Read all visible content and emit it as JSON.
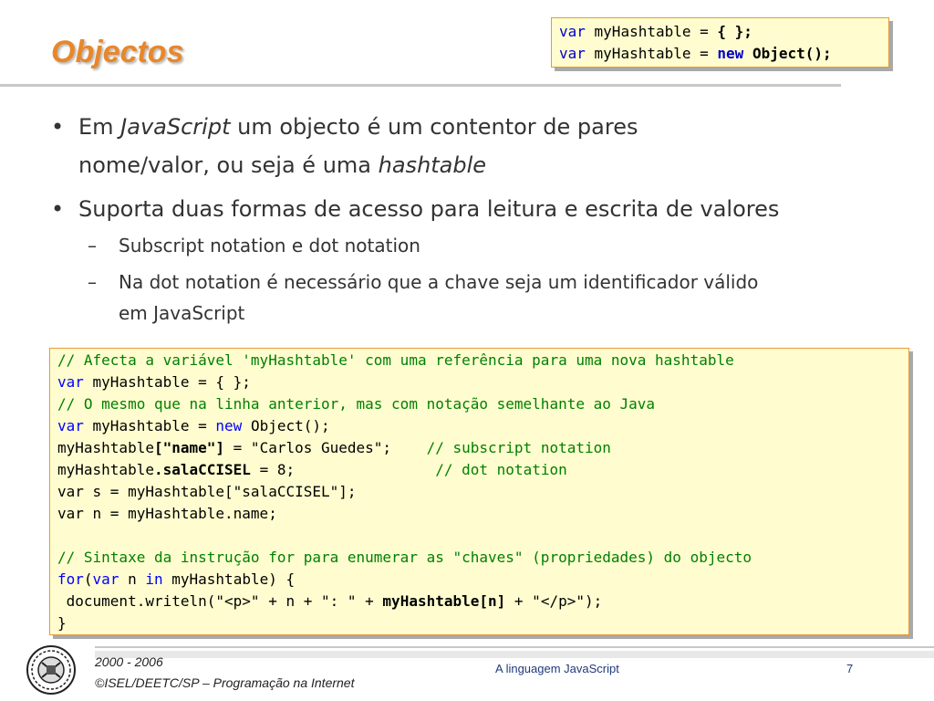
{
  "slide": {
    "title": "Objectos",
    "top_code": {
      "line1": {
        "kw": "var",
        "text": " myHashtable = ",
        "bold": "{ };"
      },
      "line2": {
        "kw": "var",
        "text": " myHashtable = ",
        "new": "new",
        "bold": " Object();"
      }
    },
    "bullets": [
      {
        "t1": "Em ",
        "i1": "JavaScript",
        "t2": " um objecto é um contentor de pares",
        "t3": "nome/valor, ou seja é uma ",
        "i2": "hashtable"
      },
      {
        "t1": "Suporta duas formas de acesso para leitura e escrita de valores"
      }
    ],
    "sub_bullets": [
      {
        "text": "Subscript notation e dot notation"
      },
      {
        "line1": "Na dot notation é necessário que a chave seja um identificador válido",
        "line2": "em JavaScript"
      }
    ],
    "bullet_glyph": "•",
    "dash_glyph": "–",
    "code": {
      "l1": "// Afecta a variável 'myHashtable' com uma referência para uma nova hashtable",
      "l2_kw": "var",
      "l2": " myHashtable = { };",
      "l3": "// O mesmo que na linha anterior, mas com notação semelhante ao Java",
      "l4_kw": "var",
      "l4_a": " myHashtable = ",
      "l4_kw2": "new",
      "l4_b": " Object();",
      "l5_a": "myHashtable",
      "l5_b": "[\"name\"]",
      "l5_c": " = \"Carlos Guedes\";    ",
      "l5_cm": "// subscript notation",
      "l6_a": "myHashtable",
      "l6_b": ".salaCCISEL",
      "l6_c": " = 8;                ",
      "l6_cm": "// dot notation",
      "l7": "var s = myHashtable[\"salaCCISEL\"];",
      "l8": "var n = myHashtable.name;",
      "l9": "// Sintaxe da instrução for para enumerar as \"chaves\" (propriedades) do objecto",
      "l10_kw1": "for",
      "l10_a": "(",
      "l10_kw2": "var",
      "l10_b": " n ",
      "l10_kw3": "in",
      "l10_c": " myHashtable) {",
      "l11_a": " document.writeln(\"<p>\" + n + \": \" + ",
      "l11_b": "myHashtable[n]",
      "l11_c": " + \"</p>\");",
      "l12": "}"
    },
    "footer": {
      "year": "2000 - 2006",
      "org": "©ISEL/DEETC/SP – Programação na Internet",
      "center": "A linguagem JavaScript",
      "page": "7"
    },
    "colors": {
      "title": "#e8872a",
      "box_bg": "#fffdd0",
      "box_border": "#e39a3c",
      "keyword": "#0000ff",
      "comment": "#008000"
    },
    "logo_icon": "isel-logo-icon"
  }
}
